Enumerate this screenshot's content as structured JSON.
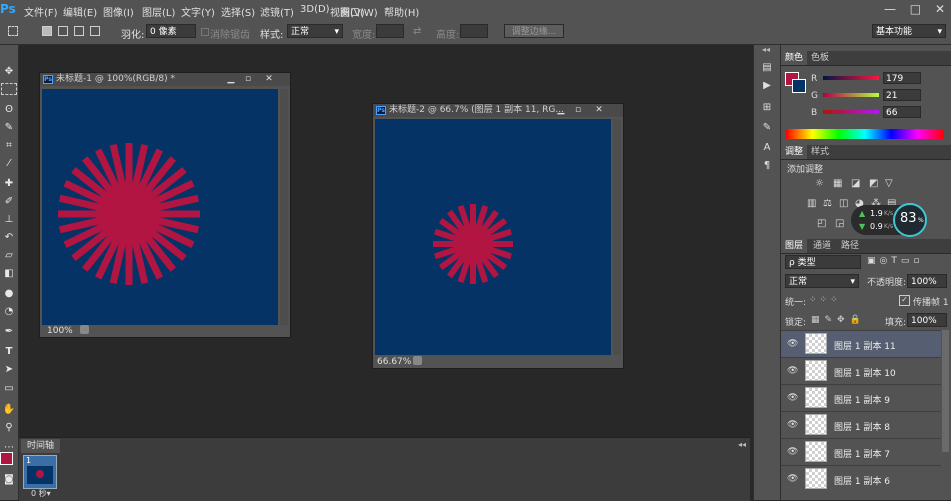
{
  "app": {
    "logo": "Ps"
  },
  "menu": [
    "文件(F)",
    "编辑(E)",
    "图像(I)",
    "图层(L)",
    "文字(Y)",
    "选择(S)",
    "滤镜(T)",
    "3D(D)",
    "视图(V)",
    "窗口(W)",
    "帮助(H)"
  ],
  "window_controls": {
    "minimize": "—",
    "restore": "□",
    "close": "✕"
  },
  "options": {
    "feather_label": "羽化:",
    "feather_value": "0 像素",
    "antialias_label": "消除锯齿",
    "style_label": "样式:",
    "style_value": "正常",
    "width_label": "宽度:",
    "height_label": "高度:",
    "refine_edge": "调整边缘...",
    "workspace": "基本功能"
  },
  "docs": [
    {
      "title": "未标题-1 @ 100%(RGB/8) *",
      "zoom": "100%"
    },
    {
      "title": "未标题-2 @ 66.7% (图层 1 副本 11, RG...",
      "zoom": "66.67%"
    }
  ],
  "timeline": {
    "tab": "时间轴",
    "frame_number": "1",
    "frame_delay": "0 秒▾"
  },
  "color_panel": {
    "tabs": [
      "颜色",
      "色板"
    ],
    "r_label": "R",
    "g_label": "G",
    "b_label": "B",
    "r": "179",
    "g": "21",
    "b": "66",
    "foreground": "#b31542"
  },
  "adjust_panel": {
    "tabs": [
      "调整",
      "样式"
    ],
    "title": "添加调整"
  },
  "hud": {
    "up": "1.9",
    "down": "0.9",
    "unit": "K/s",
    "percent": "83",
    "pct_sign": "%"
  },
  "layers_panel": {
    "tabs": [
      "图层",
      "通道",
      "路径"
    ],
    "filter_label": "ρ 类型",
    "blend_mode": "正常",
    "opacity_label": "不透明度:",
    "opacity": "100%",
    "unify_label": "统一:",
    "propagate_label": "传播帧 1",
    "lock_label": "锁定:",
    "fill_label": "填充:",
    "fill": "100%",
    "layers": [
      "图层 1 副本 11",
      "图层 1 副本 10",
      "图层 1 副本 9",
      "图层 1 副本 8",
      "图层 1 副本 7",
      "图层 1 副本 6"
    ]
  },
  "colors": {
    "canvas": "#063366",
    "sunburst": "#b31542",
    "accent": "#31a8ff"
  }
}
